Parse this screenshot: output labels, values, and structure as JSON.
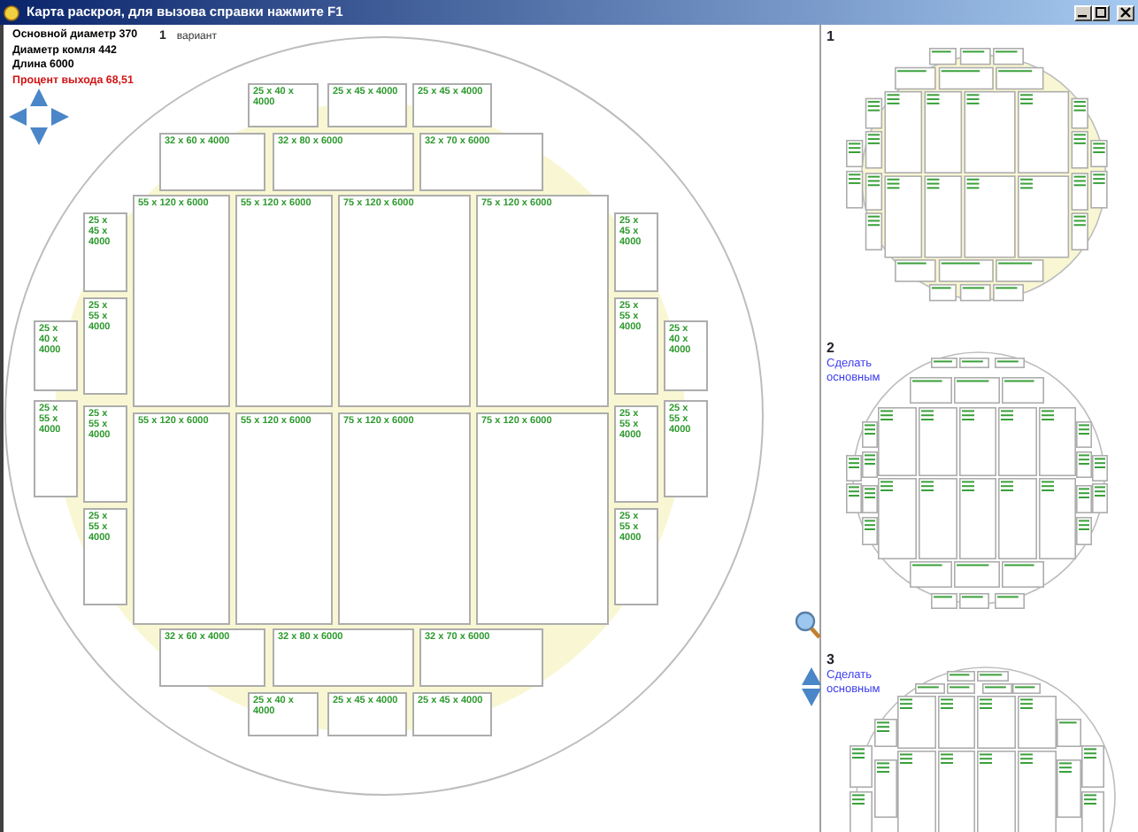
{
  "window": {
    "title": "Карта раскроя, для вызова справки нажмите  F1"
  },
  "summary": [
    {
      "text": "Основной диаметр 370",
      "kind": "info"
    },
    {
      "text": "Диаметр комля 442",
      "kind": "info"
    },
    {
      "text": "Длина 6000",
      "kind": "info"
    },
    {
      "text": "Процент выхода 68,51",
      "kind": "yield"
    }
  ],
  "variant": {
    "number": "1",
    "label": "вариант"
  },
  "main_map": {
    "pieces": [
      {
        "label": "25 x 40 x 4000"
      },
      {
        "label": "25 x 45 x 4000"
      },
      {
        "label": "25 x 45 x 4000"
      },
      {
        "label": "32 x 60 x 4000"
      },
      {
        "label": "32 x 80 x 6000"
      },
      {
        "label": "32 x 70 x 6000"
      },
      {
        "label": "55 x 120 x 6000"
      },
      {
        "label": "55 x 120 x 6000"
      },
      {
        "label": "75 x 120 x 6000"
      },
      {
        "label": "75 x 120 x 6000"
      },
      {
        "label": "55 x 120 x 6000"
      },
      {
        "label": "55 x 120 x 6000"
      },
      {
        "label": "75 x 120 x 6000"
      },
      {
        "label": "75 x 120 x 6000"
      },
      {
        "label": "25 x 45 x 4000"
      },
      {
        "label": "25 x 55 x 4000"
      },
      {
        "label": "25 x 55 x 4000"
      },
      {
        "label": "25 x 55 x 4000"
      },
      {
        "label": "25 x 40 x 4000"
      },
      {
        "label": "25 x 55 x 4000"
      },
      {
        "label": "25 x 45 x 4000"
      },
      {
        "label": "25 x 55 x 4000"
      },
      {
        "label": "25 x 55 x 4000"
      },
      {
        "label": "25 x 55 x 4000"
      },
      {
        "label": "25 x 40 x 4000"
      },
      {
        "label": "25 x 55 x 4000"
      },
      {
        "label": "32 x 60 x 4000"
      },
      {
        "label": "32 x 80 x 6000"
      },
      {
        "label": "32 x 70 x 6000"
      },
      {
        "label": "25 x 40 x 4000"
      },
      {
        "label": "25 x 45 x 4000"
      },
      {
        "label": "25 x 45 x 4000"
      }
    ]
  },
  "variants": [
    {
      "number": "1"
    },
    {
      "number": "2",
      "action": "Сделать основным"
    },
    {
      "number": "3",
      "action": "Сделать основным"
    }
  ]
}
